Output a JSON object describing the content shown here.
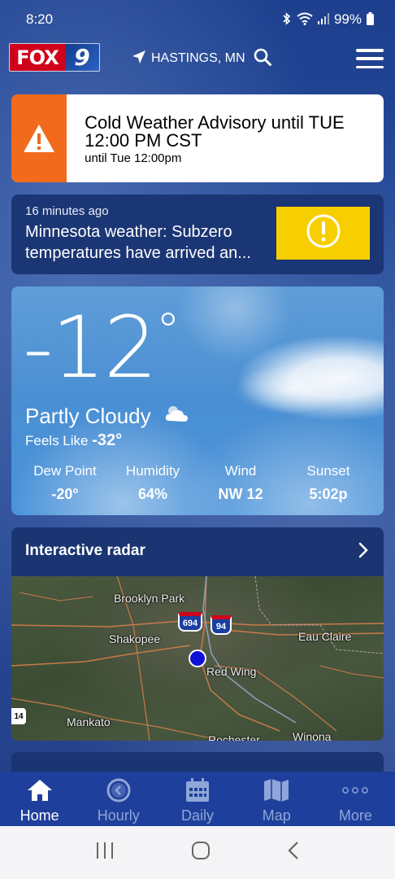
{
  "status_bar": {
    "time": "8:20",
    "battery": "99%"
  },
  "header": {
    "logo_fox": "FOX",
    "logo_nine": "9",
    "location": "HASTINGS, MN"
  },
  "advisory": {
    "title": "Cold Weather Advisory until TUE 12:00 PM CST",
    "subtitle": "until Tue 12:00pm",
    "accent_color": "#f26a1b"
  },
  "news": {
    "time": "16 minutes ago",
    "headline": "Minnesota weather: Subzero temperatures have arrived an...",
    "thumb_color": "#f7cf00"
  },
  "current": {
    "temperature": "-12",
    "degree_symbol": "°",
    "condition": "Partly Cloudy",
    "feels_like_label": "Feels Like",
    "feels_like_value": "-32°",
    "stats": [
      {
        "label": "Dew Point",
        "value": "-20°"
      },
      {
        "label": "Humidity",
        "value": "64%"
      },
      {
        "label": "Wind",
        "value": "NW 12"
      },
      {
        "label": "Sunset",
        "value": "5:02p"
      }
    ]
  },
  "radar": {
    "title": "Interactive radar",
    "places": {
      "brooklyn_park": "Brooklyn Park",
      "shakopee": "Shakopee",
      "eau_claire": "Eau Claire",
      "red_wing": "Red Wing",
      "mankato": "Mankato",
      "rochester": "Rochester",
      "winona": "Winona"
    },
    "shields": {
      "i694": "694",
      "i94": "94",
      "us14": "14"
    }
  },
  "bottom_nav": {
    "items": [
      {
        "label": "Home",
        "icon": "home-icon"
      },
      {
        "label": "Hourly",
        "icon": "clock-icon"
      },
      {
        "label": "Daily",
        "icon": "calendar-icon"
      },
      {
        "label": "Map",
        "icon": "map-icon"
      },
      {
        "label": "More",
        "icon": "more-icon"
      }
    ]
  }
}
